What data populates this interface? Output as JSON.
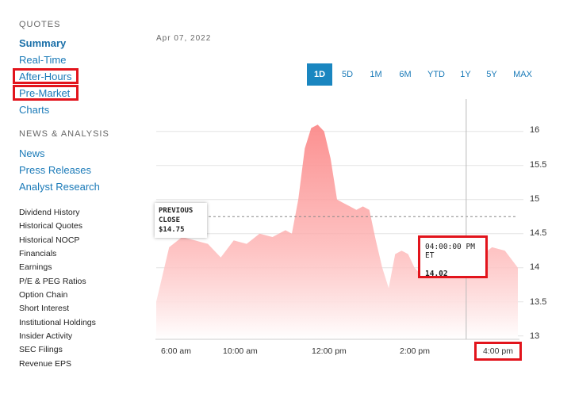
{
  "sidebar": {
    "quotes_heading": "QUOTES",
    "quote_links": [
      "Summary",
      "Real-Time",
      "After-Hours",
      "Pre-Market",
      "Charts"
    ],
    "news_heading": "NEWS & ANALYSIS",
    "news_links": [
      "News",
      "Press Releases",
      "Analyst Research"
    ],
    "data_links": [
      "Dividend History",
      "Historical Quotes",
      "Historical NOCP",
      "Financials",
      "Earnings",
      "P/E & PEG Ratios",
      "Option Chain",
      "Short Interest",
      "Institutional Holdings",
      "Insider Activity",
      "SEC Filings",
      "Revenue EPS"
    ]
  },
  "chart_header": {
    "date": "Apr 07, 2022",
    "ranges": [
      "1D",
      "5D",
      "1M",
      "6M",
      "YTD",
      "1Y",
      "5Y",
      "MAX"
    ],
    "active_range": "1D"
  },
  "tooltips": {
    "previous_close_line1": "PREVIOUS",
    "previous_close_line2": "CLOSE",
    "previous_close_value": "$14.75",
    "cursor_time": "04:00:00 PM ET",
    "cursor_value": "14.02"
  },
  "colors": {
    "accent": "#1a86c0",
    "area_top": "#fb8a8a",
    "area_bottom": "#ffffff",
    "highlight": "#e2141c",
    "link": "#1a7ab8"
  },
  "chart_data": {
    "type": "area",
    "x_tick_labels": [
      "6:00 am",
      "10:00 am",
      "12:00 pm",
      "2:00 pm",
      "4:00 pm"
    ],
    "y_tick_labels": [
      "16",
      "15.5",
      "15",
      "14.5",
      "14",
      "13.5",
      "13"
    ],
    "ylim": [
      12.95,
      16.3
    ],
    "previous_close": 14.75,
    "grid": true,
    "series": [
      {
        "x": [
          "4:00 am",
          "4:30 am",
          "5:00 am",
          "5:30 am",
          "6:00 am",
          "6:30 am",
          "7:00 am",
          "7:30 am",
          "8:00 am",
          "8:30 am",
          "9:00 am",
          "9:15 am",
          "9:30 am",
          "9:45 am",
          "10:00 am",
          "10:15 am",
          "10:30 am",
          "10:45 am",
          "11:00 am",
          "11:15 am",
          "11:30 am",
          "11:45 am",
          "12:00 pm",
          "12:15 pm",
          "12:30 pm",
          "12:45 pm",
          "1:00 pm",
          "1:15 pm",
          "1:30 pm",
          "1:45 pm",
          "2:00 pm",
          "2:15 pm",
          "2:30 pm",
          "2:45 pm",
          "3:00 pm",
          "3:15 pm",
          "3:30 pm",
          "3:45 pm",
          "4:00 pm",
          "4:30 pm",
          "5:00 pm",
          "5:30 pm",
          "6:00 pm"
        ],
        "values": [
          13.5,
          14.3,
          14.45,
          14.4,
          14.35,
          14.15,
          14.4,
          14.35,
          14.5,
          14.45,
          14.55,
          14.5,
          15.0,
          15.75,
          16.05,
          16.1,
          16.0,
          15.6,
          15.0,
          14.95,
          14.9,
          14.85,
          14.9,
          14.85,
          14.4,
          14.0,
          13.7,
          14.2,
          14.25,
          14.2,
          14.0,
          13.9,
          13.95,
          14.05,
          13.9,
          14.0,
          14.3,
          14.1,
          14.02,
          14.15,
          14.3,
          14.25,
          14.0
        ]
      }
    ]
  }
}
